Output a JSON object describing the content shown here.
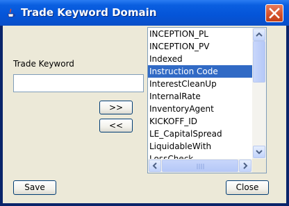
{
  "window": {
    "title": "Trade Keyword Domain"
  },
  "form": {
    "keyword_label": "Trade Keyword",
    "keyword_value": "",
    "add_label": ">>",
    "remove_label": "<<",
    "save_label": "Save",
    "close_label": "Close"
  },
  "list": {
    "items": [
      "INCEPTION_PL",
      "INCEPTION_PV",
      "Indexed",
      "Instruction Code",
      "InterestCleanUp",
      "InternalRate",
      "InventoryAgent",
      "KICKOFF_ID",
      "LE_CapitalSpread",
      "LiquidableWith",
      "LossCheck"
    ],
    "selected": "Instruction Code"
  },
  "colors": {
    "titlebar": "#0454d8",
    "selection": "#316ac5",
    "window_bg": "#ece9d8"
  }
}
